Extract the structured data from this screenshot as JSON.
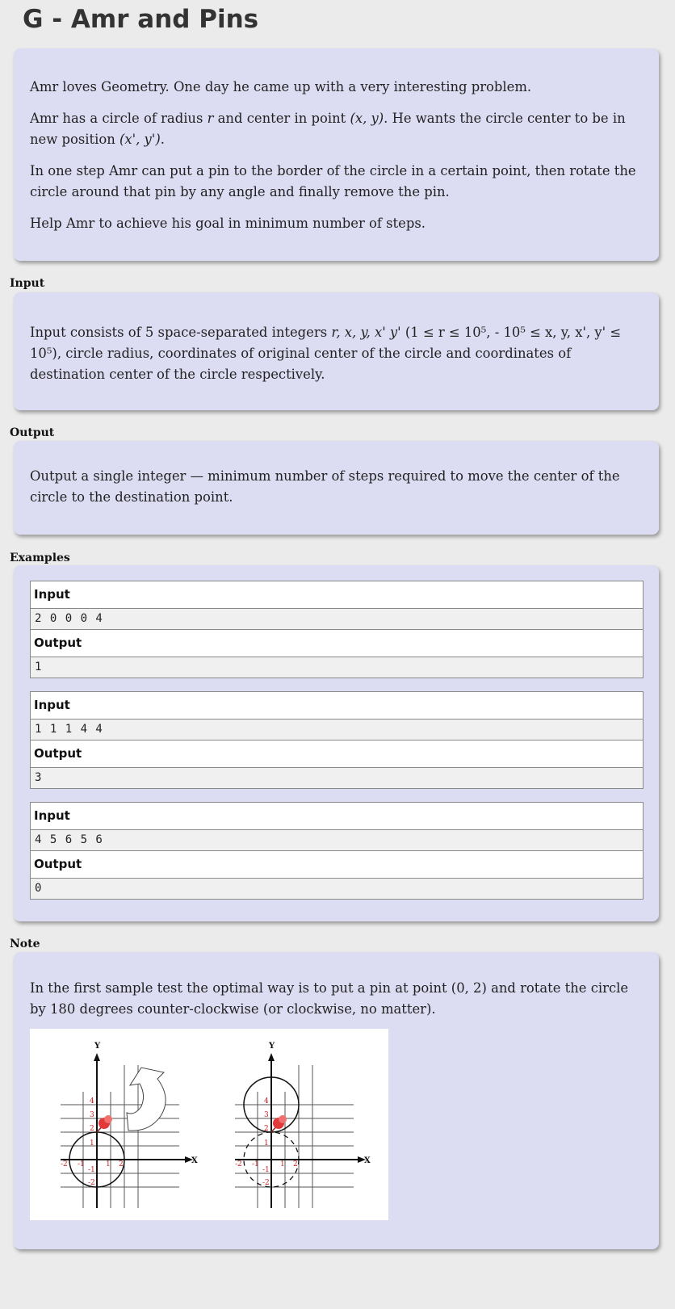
{
  "problem": {
    "title": "G - Amr and Pins"
  },
  "statement": {
    "p1": "Amr loves Geometry. One day he came up with a very interesting problem.",
    "p2_a": "Amr has a circle of radius ",
    "p2_r": "r",
    "p2_b": " and center in point ",
    "p2_xy": "(x, y)",
    "p2_c": ". He wants the circle center to be in new position",
    "p2_xy2": "(x', y')",
    "p2_d": ".",
    "p3": "In one step Amr can put a pin to the border of the circle in a certain point, then rotate the circle around that pin by any angle and finally remove the pin.",
    "p4": "Help Amr to achieve his goal in minimum number of steps."
  },
  "input_section": {
    "label": "Input",
    "text_a": "Input consists of 5 space-separated integers ",
    "vars": "r, x, y, x' y'",
    "constraints": " (1 ≤ r ≤ 10⁵,  - 10⁵ ≤ x, y, x', y' ≤ 10⁵)",
    "text_b": ", circle radius, coordinates of original center of the circle and coordinates of destination center of the circle respectively."
  },
  "output_section": {
    "label": "Output",
    "text": "Output a single integer — minimum number of steps required to move the center of the circle to the destination point."
  },
  "examples_section": {
    "label": "Examples",
    "items": [
      {
        "input_label": "Input",
        "input": "2 0 0 0 4",
        "output_label": "Output",
        "output": "1"
      },
      {
        "input_label": "Input",
        "input": "1 1 1 4 4",
        "output_label": "Output",
        "output": "3"
      },
      {
        "input_label": "Input",
        "input": "4 5 6 5 6",
        "output_label": "Output",
        "output": "0"
      }
    ]
  },
  "note_section": {
    "label": "Note",
    "text": "In the first sample test the optimal way is to put a pin at point (0, 2) and rotate the circle by 180 degrees counter-clockwise (or clockwise, no matter)."
  },
  "figure": {
    "left": {
      "y_axis": "Y",
      "x_axis": "X",
      "y_ticks": [
        "4",
        "3",
        "2",
        "1",
        "-1",
        "-2"
      ],
      "x_ticks": [
        "-2",
        "-1",
        "1",
        "2"
      ]
    },
    "right": {
      "y_axis": "Y",
      "x_axis": "X",
      "y_ticks": [
        "4",
        "3",
        "2",
        "1",
        "-1",
        "-2"
      ],
      "x_ticks": [
        "-2",
        "-1",
        "1",
        "2"
      ]
    },
    "colors": {
      "tick": "#cc2222",
      "pin": "#e23a3a",
      "axis": "#111111"
    }
  }
}
